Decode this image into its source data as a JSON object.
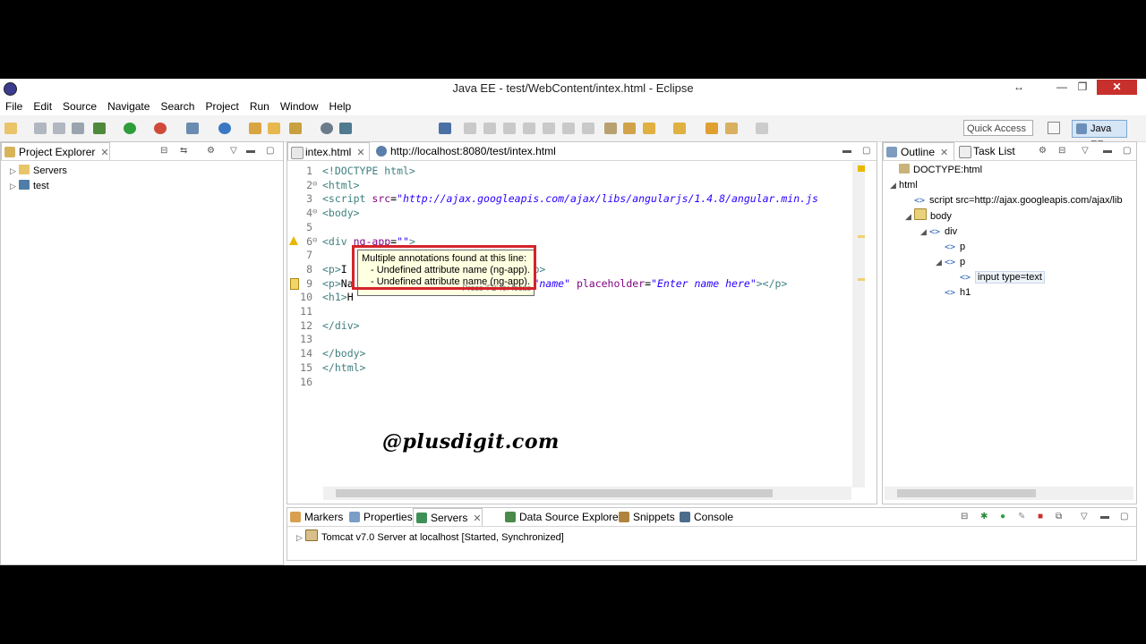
{
  "window": {
    "title": "Java EE - test/WebContent/intex.html - Eclipse",
    "controls": {
      "restore": "↔",
      "minimize": "—",
      "maximize": "❐",
      "close": "✕"
    }
  },
  "menu": [
    "File",
    "Edit",
    "Source",
    "Navigate",
    "Search",
    "Project",
    "Run",
    "Window",
    "Help"
  ],
  "toolbar": {
    "quick_access_placeholder": "Quick Access",
    "perspective": "Java EE"
  },
  "project_explorer": {
    "tab": "Project Explorer",
    "items": [
      {
        "label": "Servers",
        "icon": "folder-icon"
      },
      {
        "label": "test",
        "icon": "web-project-icon"
      }
    ]
  },
  "editor": {
    "tabs": [
      {
        "label": "intex.html"
      },
      {
        "label": "http://localhost:8080/test/intex.html"
      }
    ],
    "lines": [
      {
        "n": "1",
        "fold": "",
        "parts": [
          [
            "c-tag",
            "<!DOCTYPE html>"
          ]
        ]
      },
      {
        "n": "2",
        "fold": "⊖",
        "parts": [
          [
            "c-tag",
            "<html>"
          ]
        ]
      },
      {
        "n": "3",
        "fold": "",
        "parts": [
          [
            "c-tag",
            "<script "
          ],
          [
            "c-attr",
            "src"
          ],
          [
            "c-plain",
            "="
          ],
          [
            "c-str",
            "\"http://ajax.googleapis.com/ajax/libs/angularjs/1.4.8/angular.min.js"
          ]
        ]
      },
      {
        "n": "4",
        "fold": "⊖",
        "parts": [
          [
            "c-tag",
            "<body>"
          ]
        ]
      },
      {
        "n": "5",
        "fold": "",
        "parts": []
      },
      {
        "n": "6",
        "fold": "⊖",
        "parts": [
          [
            "c-tag",
            "<div "
          ],
          [
            "c-attr",
            "ng-app"
          ],
          [
            "c-plain",
            "="
          ],
          [
            "c-str",
            "\"\""
          ],
          [
            "c-tag",
            ">"
          ]
        ]
      },
      {
        "n": "7",
        "fold": "",
        "parts": []
      },
      {
        "n": "8",
        "fold": "",
        "parts": [
          [
            "c-tag",
            "<p>"
          ],
          [
            "c-plain",
            "I"
          ],
          [
            "c-plain",
            "                        box:"
          ],
          [
            "c-tag",
            "</p>"
          ]
        ]
      },
      {
        "n": "9",
        "fold": "",
        "parts": [
          [
            "c-tag",
            "<p>"
          ],
          [
            "c-plain",
            "Na"
          ],
          [
            "c-plain",
            "                       "
          ],
          [
            "c-attr",
            "model"
          ],
          [
            "c-plain",
            "="
          ],
          [
            "c-str",
            "\"name\""
          ],
          [
            "c-plain",
            " "
          ],
          [
            "c-attr",
            "placeholder"
          ],
          [
            "c-plain",
            "="
          ],
          [
            "c-str",
            "\"Enter name here\""
          ],
          [
            "c-tag",
            "></p>"
          ]
        ]
      },
      {
        "n": "10",
        "fold": "",
        "parts": [
          [
            "c-tag",
            "<h1>"
          ],
          [
            "c-plain",
            "H"
          ]
        ]
      },
      {
        "n": "11",
        "fold": "",
        "parts": []
      },
      {
        "n": "12",
        "fold": "",
        "parts": [
          [
            "c-tag",
            "</div>"
          ]
        ]
      },
      {
        "n": "13",
        "fold": "",
        "parts": []
      },
      {
        "n": "14",
        "fold": "",
        "parts": [
          [
            "c-tag",
            "</body>"
          ]
        ]
      },
      {
        "n": "15",
        "fold": "",
        "parts": [
          [
            "c-tag",
            "</html>"
          ]
        ]
      },
      {
        "n": "16",
        "fold": "",
        "parts": []
      }
    ],
    "hover": {
      "line1": "Multiple annotations found at this line:",
      "line2": "- Undefined attribute name (ng-app).",
      "line3": "- Undefined attribute name (ng-app).",
      "footer": "Press 'F2' for focus"
    },
    "watermark": "@plusdigit.com"
  },
  "outline": {
    "tabs": [
      "Outline",
      "Task List"
    ],
    "nodes": [
      {
        "label": "DOCTYPE:html",
        "arrow": "",
        "icon": "doctype"
      },
      {
        "label": "html",
        "arrow": "◢",
        "icon": "none"
      },
      {
        "label": "script src=http://ajax.googleapis.com/ajax/lib",
        "arrow": "",
        "icon": "tag"
      },
      {
        "label": "body",
        "arrow": "◢",
        "icon": "body"
      },
      {
        "label": "div",
        "arrow": "◢",
        "icon": "tag"
      },
      {
        "label": "p",
        "arrow": "",
        "icon": "tag"
      },
      {
        "label": "p",
        "arrow": "◢",
        "icon": "tag"
      },
      {
        "label": "input type=text",
        "arrow": "",
        "icon": "tag"
      },
      {
        "label": "h1",
        "arrow": "",
        "icon": "tag"
      }
    ]
  },
  "bottom_panel": {
    "tabs": [
      "Markers",
      "Properties",
      "Servers",
      "Data Source Explorer",
      "Snippets",
      "Console"
    ],
    "server": "Tomcat v7.0 Server at localhost  [Started, Synchronized]"
  },
  "colors": {
    "accent": "#d4232a",
    "hover_bg": "#ffffe1",
    "perspective_bg": "#d6e6f7"
  }
}
